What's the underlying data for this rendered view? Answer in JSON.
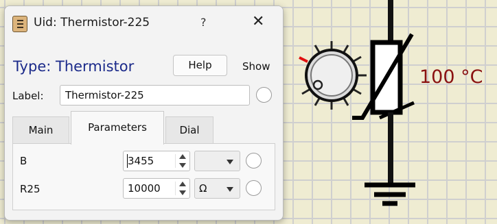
{
  "window": {
    "title": "Uid: Thermistor-225",
    "help_glyph": "?",
    "close_glyph": "✕",
    "icon": "component-icon"
  },
  "header": {
    "type_title": "Type: Thermistor",
    "help_label": "Help",
    "show_label": "Show"
  },
  "label_row": {
    "caption": "Label:",
    "value": "Thermistor-225"
  },
  "tabs": [
    {
      "label": "Main",
      "active": false
    },
    {
      "label": "Parameters",
      "active": true
    },
    {
      "label": "Dial",
      "active": false
    }
  ],
  "parameters": [
    {
      "name": "B",
      "value": "3455",
      "unit": ""
    },
    {
      "name": "R25",
      "value": "10000",
      "unit": "Ω"
    }
  ],
  "canvas": {
    "temperature_readout": "100 °C",
    "components": [
      "dial-knob",
      "thermistor",
      "ground"
    ],
    "colors": {
      "grid": "#cfcfcf",
      "background": "#efecd2",
      "readout": "#8a1111",
      "knob_marker": "#e01010"
    }
  }
}
